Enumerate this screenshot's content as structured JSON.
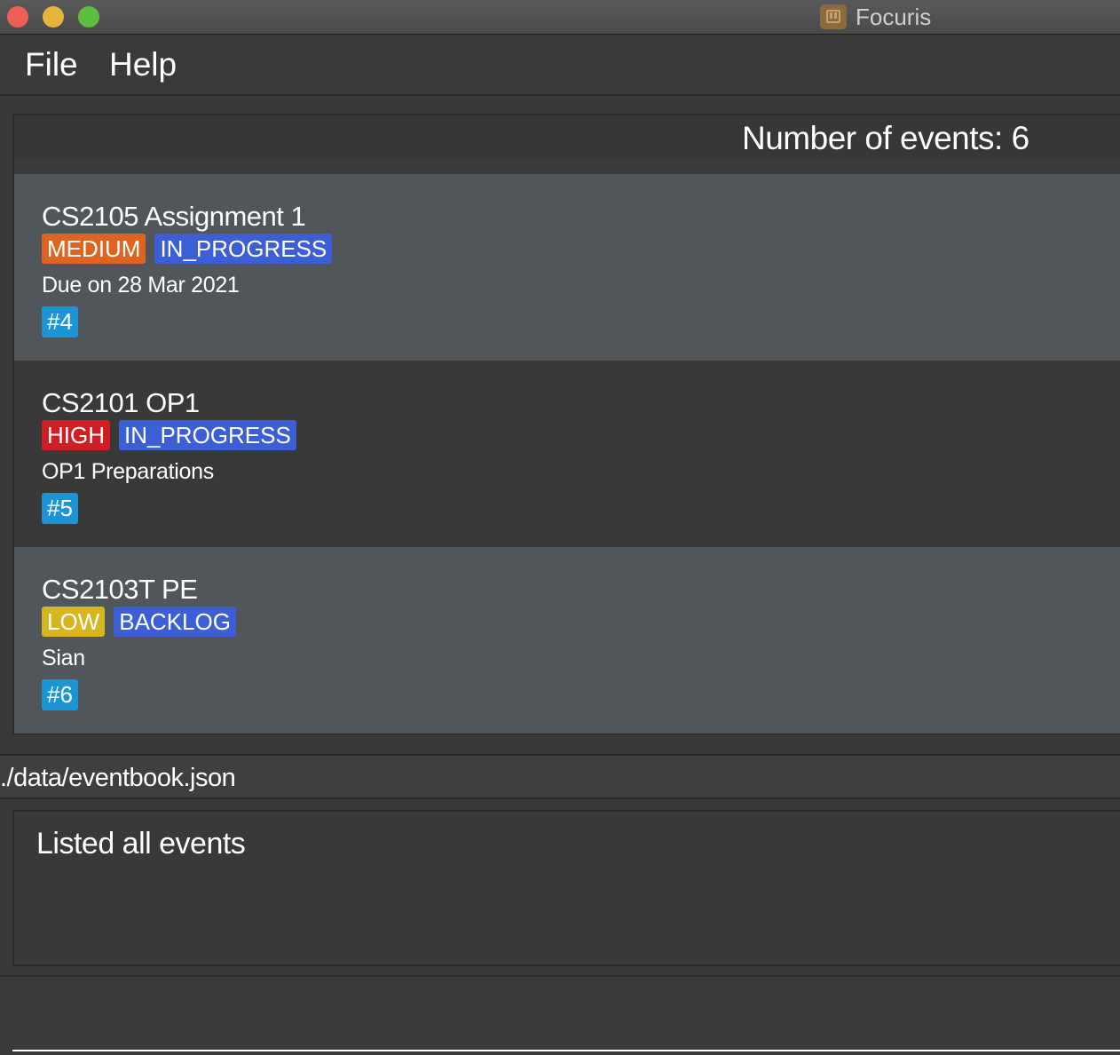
{
  "window": {
    "title": "Focuris",
    "colors": {
      "close": "#ec5f57",
      "minimize": "#e4b53a",
      "maximize": "#5bbe3e"
    }
  },
  "menu": {
    "file": "File",
    "help": "Help"
  },
  "event_list": {
    "count_text": "Number of events: 6",
    "events": [
      {
        "title": "CS2105 Assignment 1",
        "priority": "MEDIUM",
        "priority_color": "#de6421",
        "status": "IN_PROGRESS",
        "status_color": "#3d5fd6",
        "description": "Due on 28 Mar 2021",
        "id": "#4"
      },
      {
        "title": "CS2101 OP1",
        "priority": "HIGH",
        "priority_color": "#cf1e24",
        "status": "IN_PROGRESS",
        "status_color": "#3d5fd6",
        "description": "OP1 Preparations",
        "id": "#5"
      },
      {
        "title": "CS2103T PE",
        "priority": "LOW",
        "priority_color": "#d7b51f",
        "status": "BACKLOG",
        "status_color": "#3d5fd6",
        "description": "Sian",
        "id": "#6"
      }
    ]
  },
  "status_bar": {
    "path": "./data/eventbook.json"
  },
  "result_display": {
    "text": "Listed all events"
  },
  "command_box": {
    "value": ""
  }
}
